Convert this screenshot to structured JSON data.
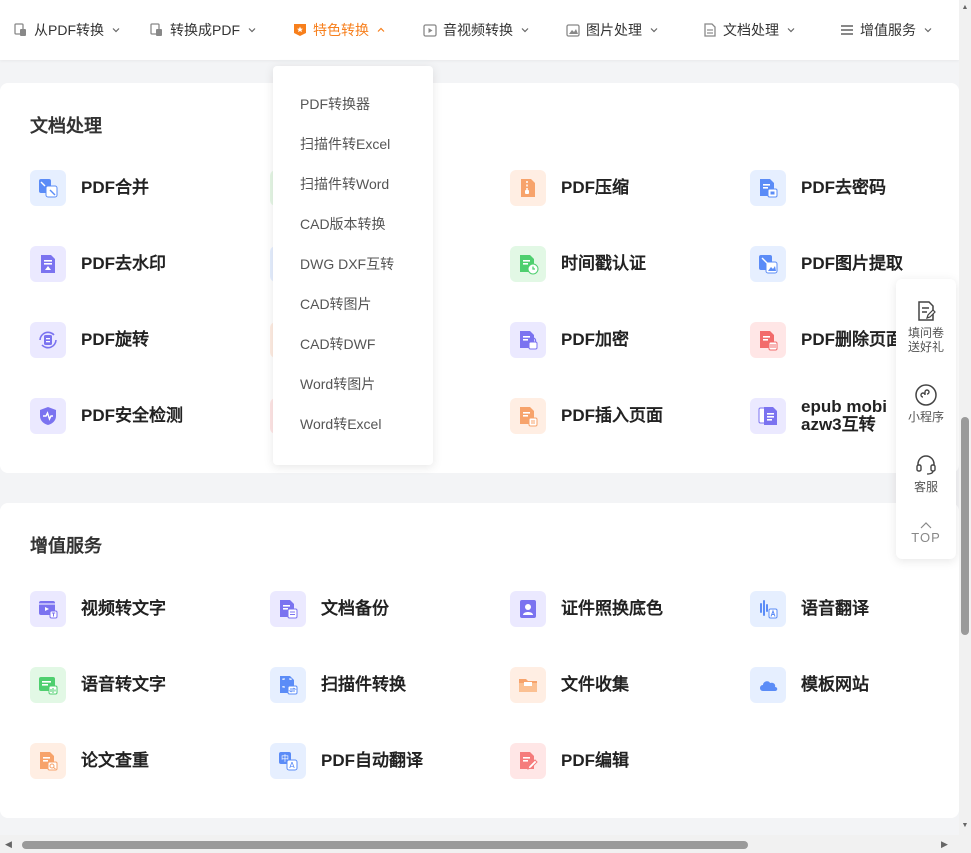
{
  "nav": {
    "items": [
      {
        "label": "从PDF转换",
        "icon": "pdf-file-icon"
      },
      {
        "label": "转换成PDF",
        "icon": "convert-icon"
      },
      {
        "label": "特色转换",
        "icon": "star-badge-icon",
        "active": true
      },
      {
        "label": "音视频转换",
        "icon": "play-icon"
      },
      {
        "label": "图片处理",
        "icon": "image-icon"
      },
      {
        "label": "文档处理",
        "icon": "document-icon"
      },
      {
        "label": "增值服务",
        "icon": "list-icon"
      }
    ],
    "accent_color": "#f77f1c"
  },
  "dropdown": {
    "items": [
      "PDF转换器",
      "扫描件转Excel",
      "扫描件转Word",
      "CAD版本转换",
      "DWG DXF互转",
      "CAD转图片",
      "CAD转DWF",
      "Word转图片",
      "Word转Excel"
    ]
  },
  "doc_section": {
    "title": "文档处理",
    "tools": [
      {
        "label": "PDF合并",
        "icon": "merge-icon"
      },
      {
        "label": "PDF压缩",
        "icon": "compress-icon"
      },
      {
        "label": "PDF去密码",
        "icon": "unlock-icon"
      },
      {
        "label": "PDF去水印",
        "icon": "watermark-icon"
      },
      {
        "label": "时间戳认证",
        "icon": "timestamp-icon"
      },
      {
        "label": "PDF图片提取",
        "icon": "image-extract-icon"
      },
      {
        "label": "PDF旋转",
        "icon": "rotate-icon"
      },
      {
        "label": "PDF加密",
        "icon": "lock-icon"
      },
      {
        "label": "PDF删除页面",
        "icon": "delete-page-icon"
      },
      {
        "label": "PDF安全检测",
        "icon": "shield-icon"
      },
      {
        "label": "PDF插入页面",
        "icon": "insert-page-icon"
      },
      {
        "label": "epub mobi azw3互转",
        "icon": "ebook-icon"
      }
    ]
  },
  "vip_section": {
    "title": "增值服务",
    "tools": [
      {
        "label": "视频转文字",
        "icon": "video-text-icon"
      },
      {
        "label": "文档备份",
        "icon": "backup-icon"
      },
      {
        "label": "证件照换底色",
        "icon": "id-photo-icon"
      },
      {
        "label": "语音翻译",
        "icon": "voice-translate-icon"
      },
      {
        "label": "语音转文字",
        "icon": "voice-text-icon"
      },
      {
        "label": "扫描件转换",
        "icon": "scan-icon"
      },
      {
        "label": "文件收集",
        "icon": "folder-icon"
      },
      {
        "label": "模板网站",
        "icon": "cloud-icon"
      },
      {
        "label": "论文查重",
        "icon": "paper-check-icon"
      },
      {
        "label": "PDF自动翻译",
        "icon": "translate-icon"
      },
      {
        "label": "PDF编辑",
        "icon": "edit-icon"
      }
    ]
  },
  "float_panel": {
    "survey": "填问卷送好礼",
    "survey_line1": "填问卷",
    "survey_line2": "送好礼",
    "mini_program": "小程序",
    "service": "客服",
    "top": "TOP"
  }
}
